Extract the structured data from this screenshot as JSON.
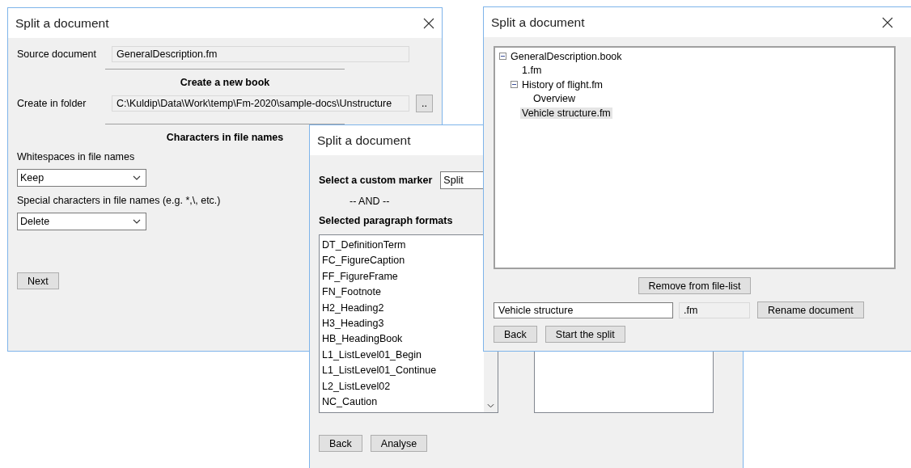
{
  "windows": [
    {
      "kind": "options",
      "title": "Split a document",
      "has_close": true,
      "source_label": "Source document",
      "source_value": "GeneralDescription.fm",
      "book_heading": "Create a new book",
      "folder_label": "Create in folder",
      "folder_value": "C:\\Kuldip\\Data\\Work\\temp\\Fm-2020\\sample-docs\\Unstructure",
      "browse_button": "..",
      "chars_heading": "Characters in file names",
      "selects": [
        {
          "label": "Whitespaces in file names",
          "value": "Keep"
        },
        {
          "label": "Special characters in file names (e.g. *,\\, etc.)",
          "value": "Delete"
        }
      ],
      "buttons": [
        "Next"
      ]
    },
    {
      "kind": "formats",
      "title": "Split a document",
      "has_close": false,
      "marker_label": "Select a custom marker",
      "marker_value": "Split",
      "and_text": "-- AND --",
      "formats_label": "Selected paragraph formats",
      "formats": [
        "DT_DefinitionTerm",
        "FC_FigureCaption",
        "FF_FigureFrame",
        "FN_Footnote",
        "H2_Heading2",
        "H3_Heading3",
        "HB_HeadingBook",
        "L1_ListLevel01_Begin",
        "L1_ListLevel01_Continue",
        "L2_ListLevel02",
        "NC_Caution"
      ],
      "buttons": [
        "Back",
        "Analyse"
      ]
    },
    {
      "kind": "tree",
      "title": "Split a document",
      "has_close": true,
      "tree": [
        {
          "label": "GeneralDescription.book",
          "expanded": true,
          "selected": false,
          "children": [
            {
              "label": "1.fm",
              "selected": false
            },
            {
              "label": "History of flight.fm",
              "expanded": true,
              "selected": false,
              "children": [
                {
                  "label": "Overview",
                  "selected": false
                }
              ]
            },
            {
              "label": "Vehicle structure.fm",
              "selected": true
            }
          ]
        }
      ],
      "remove_button": "Remove from file-list",
      "name_value": "Vehicle structure",
      "extension": ".fm",
      "rename_button": "Rename document",
      "buttons": [
        "Back",
        "Start the split"
      ]
    }
  ]
}
